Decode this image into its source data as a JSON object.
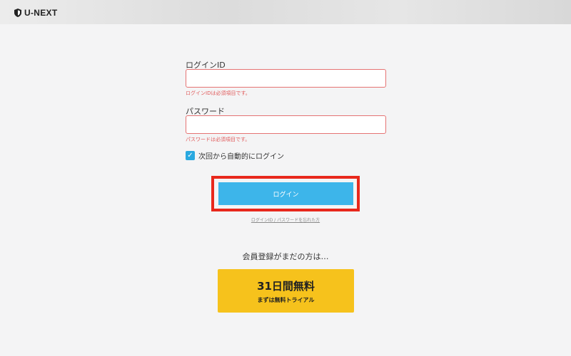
{
  "header": {
    "logo_text": "U-NEXT",
    "logo_icon": "shield-logo-icon"
  },
  "login_form": {
    "login_id_label": "ログインID",
    "login_id_value": "",
    "login_id_error": "ログインIDは必須項目です。",
    "password_label": "パスワード",
    "password_value": "",
    "password_error": "パスワードは必須項目です。",
    "remember_checked": true,
    "remember_label": "次回から自動的にログイン",
    "login_button_label": "ログイン",
    "forgot_link": "ログインID / パスワードを忘れた方"
  },
  "signup": {
    "prompt": "会員登録がまだの方は…",
    "trial_main": "31日間無料",
    "trial_sub": "まずは無料トライアル"
  },
  "colors": {
    "accent": "#3db5ea",
    "error": "#e05a5a",
    "highlight": "#e8281c",
    "trial": "#f6c21c"
  }
}
